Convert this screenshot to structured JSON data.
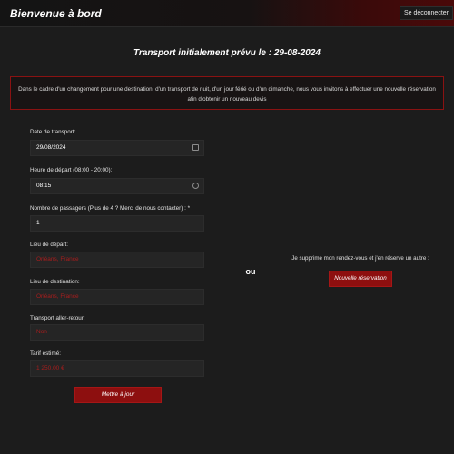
{
  "header": {
    "brand": "Bienvenue à bord",
    "logout_label": "Se déconnecter"
  },
  "page": {
    "title": "Transport initialement prévu le : 29-08-2024"
  },
  "alert": {
    "text": "Dans le cadre d'un changement pour une destination, d'un transport de nuit, d'un jour férié ou d'un dimanche, nous vous invitons à effectuer une nouvelle réservation afin d'obtenir un nouveau devis"
  },
  "form": {
    "date": {
      "label": "Date de transport:",
      "value": "29/08/2024",
      "icon": "calendar-icon"
    },
    "time": {
      "label": "Heure de départ (08:00 - 20:00):",
      "value": "08:15",
      "icon": "clock-icon"
    },
    "passengers": {
      "label": "Nombre de passagers (Plus de 4 ? Merci de nous contacter) : *",
      "value": "1"
    },
    "departure": {
      "label": "Lieu de départ:",
      "value": "Orléans, France"
    },
    "destination": {
      "label": "Lieu de destination:",
      "value": "Orléans, France"
    },
    "round_trip": {
      "label": "Transport aller-retour:",
      "value": "Non"
    },
    "price": {
      "label": "Tarif estimé:",
      "value": "1 250.00 €"
    },
    "submit_label": "Mettre à jour"
  },
  "alternative": {
    "separator": "ou",
    "text": "Je supprime mon rendez-vous et j'en réserve un autre :",
    "button_label": "Nouvelle réservation"
  },
  "colors": {
    "accent": "#8d0f0f",
    "background": "#1c1c1c",
    "readonly_text": "#a81d1d"
  }
}
